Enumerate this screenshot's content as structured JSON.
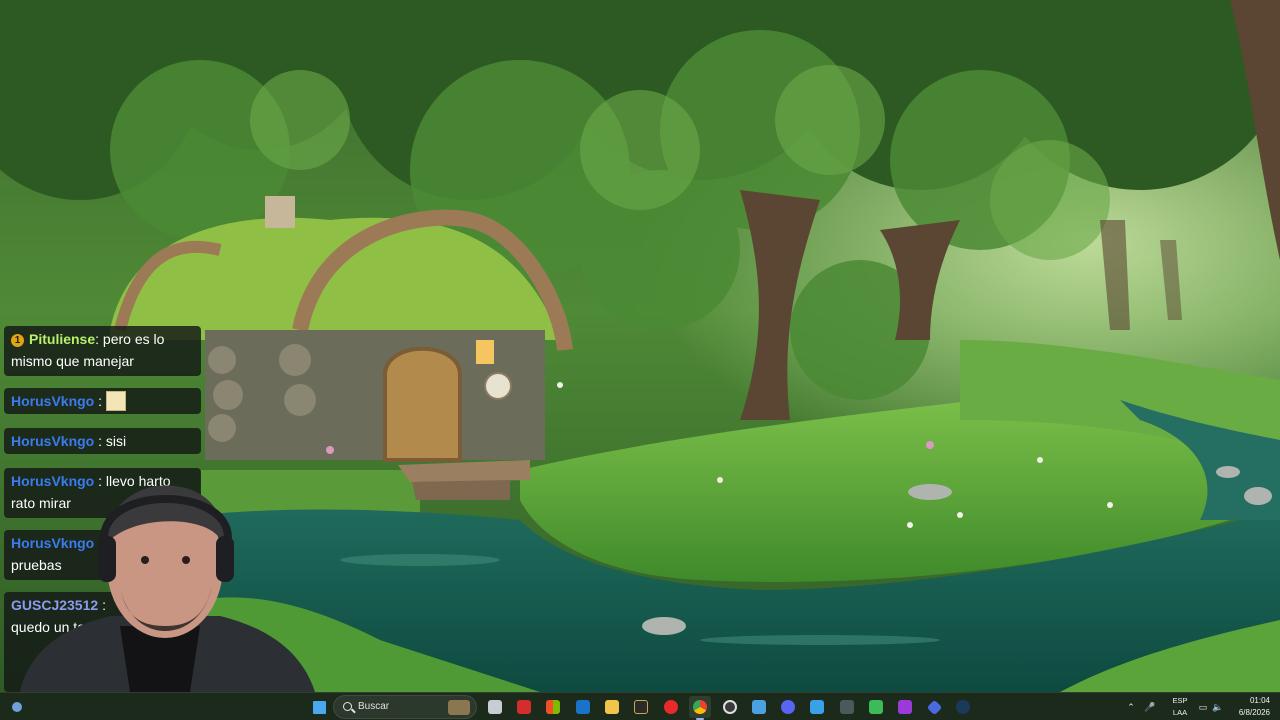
{
  "chat": {
    "messages": [
      {
        "user": "Pituliense",
        "separator": ":",
        "text": "pero es lo mismo que manejar",
        "user_color": "#b8f06a",
        "badge": "1"
      },
      {
        "user": "HorusVkngo",
        "separator": ":",
        "text": "",
        "user_color": "#3a7bf0",
        "emote": "pepe-emote"
      },
      {
        "user": "HorusVkngo",
        "separator": ":",
        "text": "sisi",
        "user_color": "#3a7bf0"
      },
      {
        "user": "HorusVkngo",
        "separator": ":",
        "text": "llevo harto rato mirar",
        "user_color": "#3a7bf0"
      },
      {
        "user": "HorusVkngo",
        "separator": "",
        "text": "pruebas",
        "user_color": "#3a7bf0"
      },
      {
        "user": "GUSCJ23512",
        "separator": ":",
        "text": "quedo un ten h",
        "user_color": "#8a9cf0"
      }
    ]
  },
  "taskbar": {
    "search_placeholder": "Buscar",
    "language": "ESP",
    "language_region": "LAA",
    "time": "01:04",
    "date": "6/8/2026",
    "icons": [
      "task-view-icon",
      "mcafee-icon",
      "microsoft-store-icon",
      "outlook-icon",
      "file-explorer-icon",
      "vegas-pro-icon",
      "youtube-music-icon",
      "chrome-icon",
      "obs-studio-icon",
      "notepad-icon",
      "discord-icon",
      "photos-icon",
      "capture-icon",
      "android-studio-icon",
      "podcast-icon",
      "app-blue-icon",
      "steam-icon"
    ],
    "colors": {
      "accent": "#9bb0e8",
      "taskbar_bg": "#1c2a1c"
    }
  }
}
